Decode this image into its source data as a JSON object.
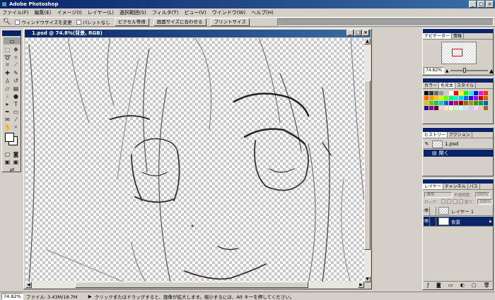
{
  "app": {
    "title": "Adobe Photoshop",
    "window_buttons": [
      "_",
      "□",
      "×"
    ]
  },
  "menu": [
    "ファイル(F)",
    "編集(E)",
    "イメージ(I)",
    "レイヤー(L)",
    "選択範囲(S)",
    "フィルタ(T)",
    "ビュー(V)",
    "ウインドウ(W)",
    "ヘルプ(H)"
  ],
  "options": {
    "check1": "ウィンドウサイズを変更",
    "check2": "パレットなし",
    "btn1": "ピクセル等倍",
    "btn2": "画面サイズに合わせる",
    "btn3": "プリントサイズ"
  },
  "document": {
    "title": "1.psd @ 74.8%(背景, RGB)"
  },
  "navigator": {
    "tabs": [
      "ナビゲーター",
      "情報"
    ],
    "zoom": "74.82%"
  },
  "color_panel": {
    "tabs": [
      "カラー",
      "色見本",
      "スタイル"
    ]
  },
  "history": {
    "tabs": [
      "ヒストリー",
      "アクション"
    ],
    "items": [
      "1.psd",
      "開く"
    ]
  },
  "layers": {
    "tabs": [
      "レイヤー",
      "チャンネル",
      "パス"
    ],
    "blend_mode": "通常",
    "opacity_label": "不透明度：",
    "opacity": "100%",
    "fill_label": "塗り：",
    "fill": "100%",
    "lock_label": "ロック：",
    "rows": [
      {
        "name": "レイヤー 1",
        "selected": false
      },
      {
        "name": "背景",
        "selected": true
      }
    ]
  },
  "status": {
    "zoom": "74.82%",
    "file_info": "ファイル: 3.43M/18.7M",
    "hint": "クリックまたはドラッグすると、画像が拡大します。縮小するには、Alt キーを押してください。"
  },
  "swatch_colors": [
    "#000000",
    "#333333",
    "#666666",
    "#999999",
    "#cccccc",
    "#ffffff",
    "#ff0000",
    "#ffff00",
    "#00ff00",
    "#00ffff",
    "#0000ff",
    "#ff00ff",
    "#ff3300",
    "#ff6600",
    "#ff9900",
    "#ffcc00",
    "#ccff00",
    "#66ff00",
    "#00ff66",
    "#00ffcc",
    "#00ccff",
    "#0066ff",
    "#3300ff",
    "#9900ff",
    "#cc0000",
    "#cc6600",
    "#cccc00",
    "#66cc00",
    "#00cc66",
    "#00cccc",
    "#0066cc",
    "#6600cc",
    "#cc0066",
    "#990000",
    "#996600",
    "#999900",
    "#339900",
    "#009966",
    "#006699",
    "#330099",
    "#990099",
    "#660033",
    "#ffcccc",
    "#ffe5cc",
    "#ffffcc",
    "#ccffcc",
    "#ccffff",
    "#cce5ff",
    "#ccccff",
    "#ffccff",
    "#e6ccb3",
    "#996633"
  ]
}
